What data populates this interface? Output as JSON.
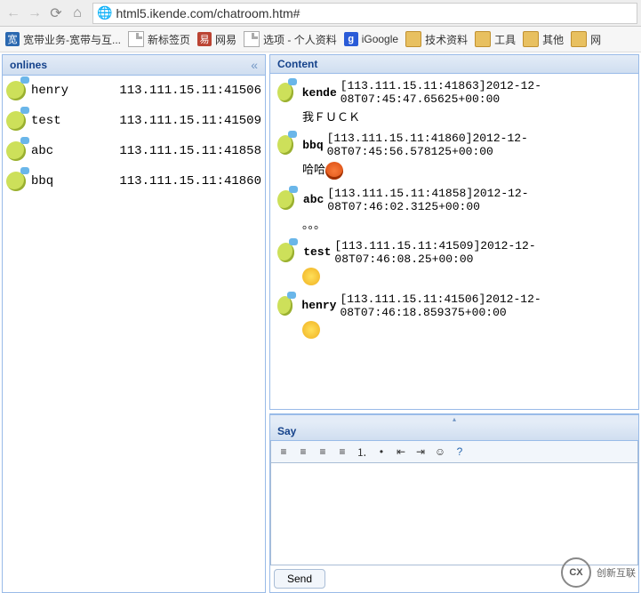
{
  "browser": {
    "url": "html5.ikende.com/chatroom.htm#"
  },
  "bookmarks": [
    {
      "label": "宽带业务-宽带与互...",
      "icon": "blue",
      "glyph": "宽"
    },
    {
      "label": "新标签页",
      "icon": "doc",
      "glyph": ""
    },
    {
      "label": "网易",
      "icon": "red",
      "glyph": "易"
    },
    {
      "label": "选项 - 个人资料",
      "icon": "doc",
      "glyph": ""
    },
    {
      "label": "iGoogle",
      "icon": "google",
      "glyph": "g"
    },
    {
      "label": "技术资料",
      "icon": "folder",
      "glyph": ""
    },
    {
      "label": "工具",
      "icon": "folder",
      "glyph": ""
    },
    {
      "label": "其他",
      "icon": "folder",
      "glyph": ""
    },
    {
      "label": "网",
      "icon": "folder",
      "glyph": ""
    }
  ],
  "panels": {
    "onlines_title": "onlines",
    "content_title": "Content",
    "say_title": "Say"
  },
  "onlines": [
    {
      "name": "henry",
      "addr": "113.111.15.11:41506"
    },
    {
      "name": "test",
      "addr": "113.111.15.11:41509"
    },
    {
      "name": "abc",
      "addr": "113.111.15.11:41858"
    },
    {
      "name": "bbq",
      "addr": "113.111.15.11:41860"
    }
  ],
  "messages": [
    {
      "user": "kende",
      "meta": "[113.111.15.11:41863]2012-12-08T07:45:47.65625+00:00",
      "body_text": "我ＦＵＣＫ",
      "emoji": null
    },
    {
      "user": "bbq",
      "meta": "[113.111.15.11:41860]2012-12-08T07:45:56.578125+00:00",
      "body_text": "哈哈",
      "emoji": "angry"
    },
    {
      "user": "abc",
      "meta": "[113.111.15.11:41858]2012-12-08T07:46:02.3125+00:00",
      "body_text": "。。。",
      "emoji": null
    },
    {
      "user": "test",
      "meta": "[113.111.15.11:41509]2012-12-08T07:46:08.25+00:00",
      "body_text": "",
      "emoji": "think"
    },
    {
      "user": "henry",
      "meta": "[113.111.15.11:41506]2012-12-08T07:46:18.859375+00:00",
      "body_text": "",
      "emoji": "grin"
    }
  ],
  "send_label": "Send",
  "watermark_text": "创新互联"
}
